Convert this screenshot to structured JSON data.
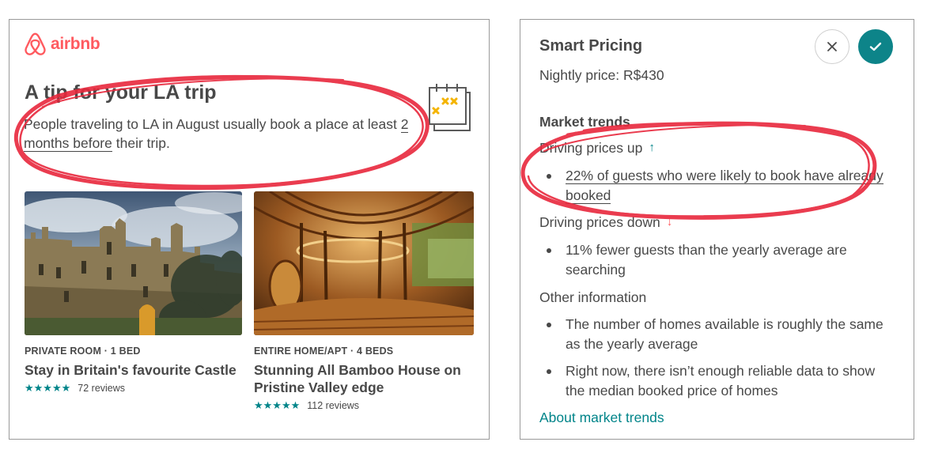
{
  "left_card": {
    "logo_text": "airbnb",
    "tip_title": "A tip for your LA trip",
    "tip_text_pre": "People traveling to LA in August usually book a place at least ",
    "tip_text_underline": "2 months before",
    "tip_text_post": " their trip.",
    "calendar_icon": "calendar-icon",
    "listings": [
      {
        "meta": "PRIVATE ROOM · 1 BED",
        "title": "Stay in Britain's favourite Castle",
        "stars": "★★★★★",
        "reviews": "72 reviews"
      },
      {
        "meta": "ENTIRE HOME/APT · 4 BEDS",
        "title": "Stunning All Bamboo House on Pristine Valley edge",
        "stars": "★★★★★",
        "reviews": "112 reviews"
      }
    ]
  },
  "smart_pricing": {
    "title": "Smart Pricing",
    "nightly_price": "Nightly price: R$430",
    "close_icon": "close-icon",
    "confirm_icon": "check-icon",
    "market_trends_title": "Market trends",
    "up_label": "Driving prices up",
    "up_arrow": "↑",
    "up_bullet_underlined": "22% of guests who were likely to book have already booked",
    "down_label": "Driving prices down",
    "down_arrow": "↓",
    "down_bullet": "11% fewer guests than the yearly average are searching",
    "other_label": "Other information",
    "other_bullets": [
      "The number of homes available is roughly the same as the yearly average",
      "Right now, there isn’t enough reliable data to show the median booked price of homes"
    ],
    "link": "About market trends"
  },
  "colors": {
    "brand": "#FF5A5F",
    "teal": "#008489",
    "text": "#484848",
    "annotation_red": "#E8283C"
  }
}
